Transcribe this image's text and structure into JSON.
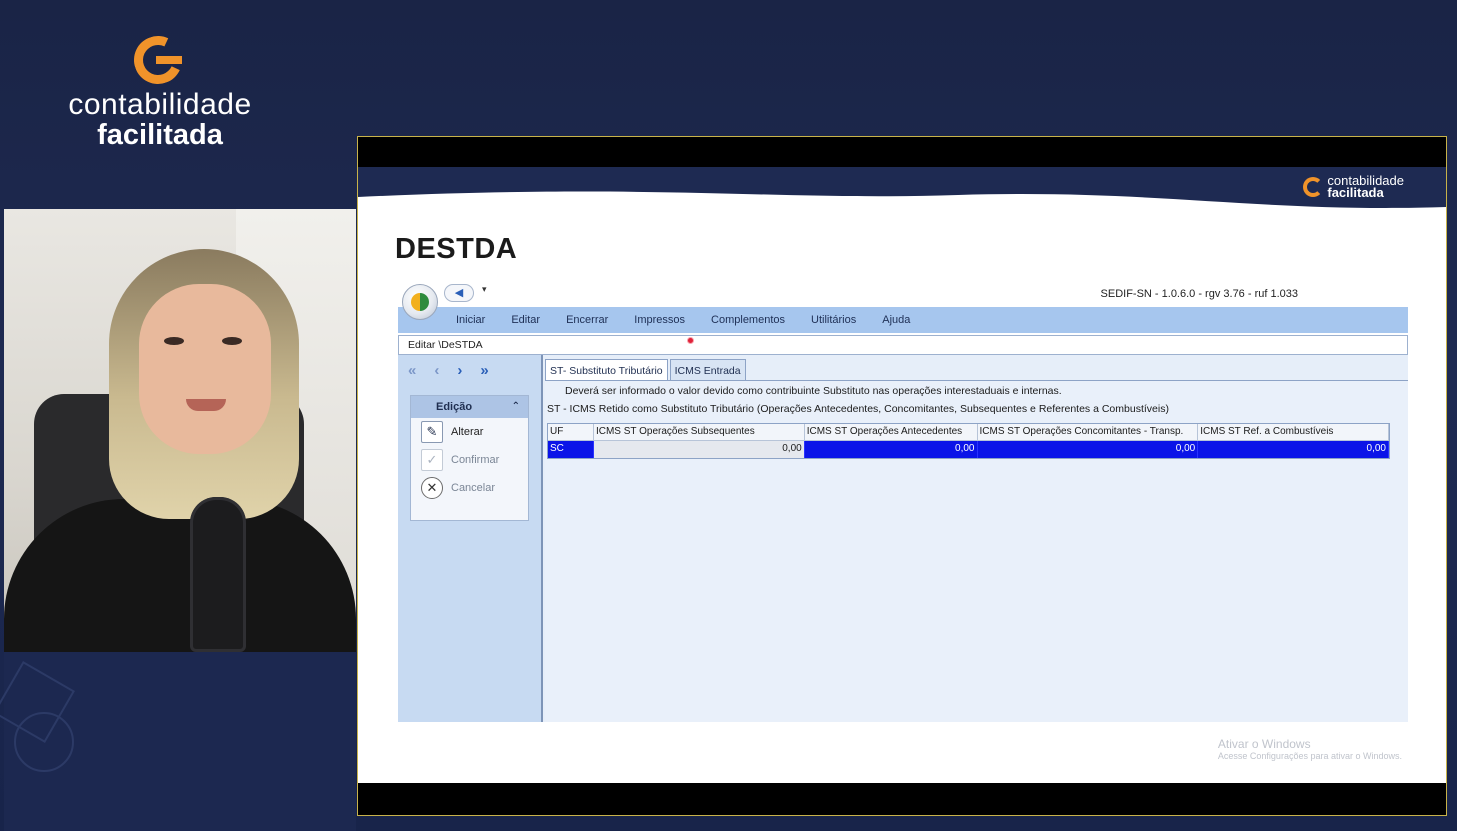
{
  "brand": {
    "name_line1": "contabilidade",
    "name_line2": "facilitada",
    "accent_color": "#f0932a"
  },
  "slide": {
    "logo_line1": "contabilidade",
    "logo_line2": "facilitada",
    "title": "DESTDA"
  },
  "app": {
    "version": "SEDIF-SN - 1.0.6.0 - rgv 3.76 - ruf 1.033",
    "quick_access_dropdown": "▾",
    "menu": [
      "Iniciar",
      "Editar",
      "Encerrar",
      "Impressos",
      "Complementos",
      "Utilitários",
      "Ajuda"
    ],
    "path": "Editar \\DeSTDA",
    "nav_icons": [
      "first-icon",
      "prev-icon",
      "next-icon",
      "last-icon"
    ],
    "group": {
      "title": "Edição",
      "actions": [
        {
          "label": "Alterar",
          "icon": "pencil-icon",
          "enabled": true
        },
        {
          "label": "Confirmar",
          "icon": "check-icon",
          "enabled": false
        },
        {
          "label": "Cancelar",
          "icon": "cancel-icon",
          "enabled": false
        }
      ]
    },
    "tabs": [
      "ST- Substituto Tributário",
      "ICMS Entrada"
    ],
    "active_tab": 0,
    "description_1": "Deverá ser informado o valor devido como contribuinte Substituto nas operações interestaduais e internas.",
    "description_2": "ST - ICMS Retido como Substituto Tributário (Operações Antecedentes, Concomitantes, Subsequentes e Referentes a Combustíveis)",
    "grid": {
      "columns": [
        "UF",
        "ICMS ST Operações Subsequentes",
        "ICMS ST Operações Antecedentes",
        "ICMS ST Operações Concomitantes - Transp.",
        "ICMS ST Ref. a Combustíveis"
      ],
      "rows": [
        [
          "SC",
          "0,00",
          "0,00",
          "0,00",
          "0,00"
        ]
      ],
      "selection_color": "#0b14e8"
    }
  },
  "watermark": {
    "line1": "Ativar o Windows",
    "line2": "Acesse Configurações para ativar o Windows."
  }
}
